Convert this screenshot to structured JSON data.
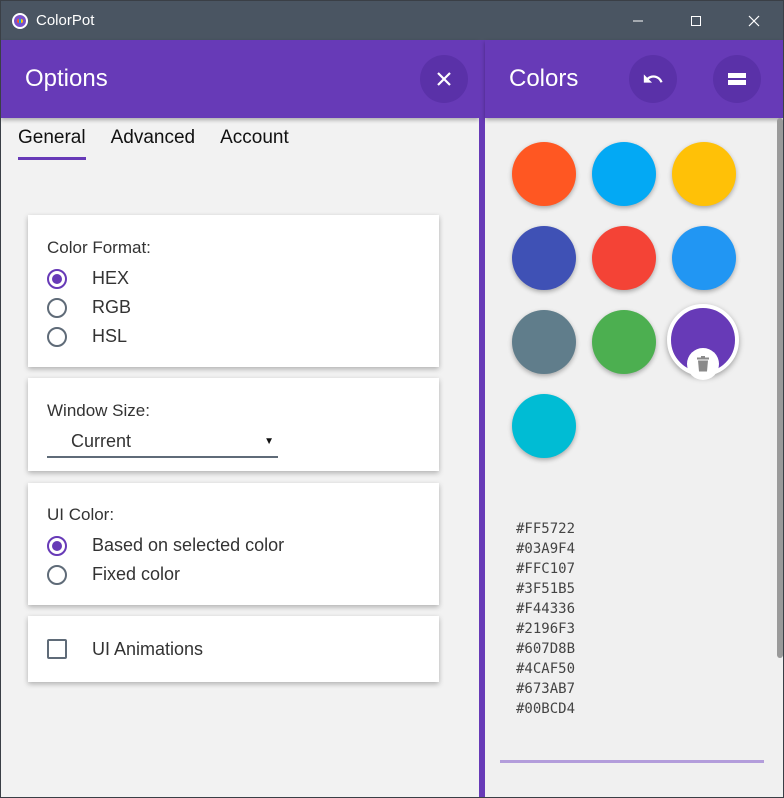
{
  "window": {
    "title": "ColorPot"
  },
  "options": {
    "title": "Options",
    "tabs": [
      "General",
      "Advanced",
      "Account"
    ],
    "active_tab": "General",
    "color_format": {
      "label": "Color Format:",
      "options": [
        "HEX",
        "RGB",
        "HSL"
      ],
      "selected": "HEX"
    },
    "window_size": {
      "label": "Window Size:",
      "value": "Current"
    },
    "ui_color": {
      "label": "UI Color:",
      "options": [
        "Based on selected color",
        "Fixed color"
      ],
      "selected": "Based on selected color"
    },
    "ui_animations": {
      "label": "UI Animations",
      "checked": false
    }
  },
  "colors": {
    "title": "Colors",
    "swatches": [
      "#FF5722",
      "#03A9F4",
      "#FFC107",
      "#3F51B5",
      "#F44336",
      "#2196F3",
      "#607D8B",
      "#4CAF50",
      "#673AB7",
      "#00BCD4"
    ],
    "selected": "#673AB7",
    "hex_list": [
      "#FF5722",
      "#03A9F4",
      "#FFC107",
      "#3F51B5",
      "#F44336",
      "#2196F3",
      "#607D8B",
      "#4CAF50",
      "#673AB7",
      "#00BCD4"
    ]
  },
  "theme": {
    "accent": "#673AB7",
    "titlebar": "#4A5562"
  },
  "icons": {
    "close": "close-icon",
    "undo": "undo-icon",
    "menu": "menu-icon",
    "trash": "trash-icon",
    "minimize": "minimize-icon",
    "maximize": "maximize-icon"
  }
}
